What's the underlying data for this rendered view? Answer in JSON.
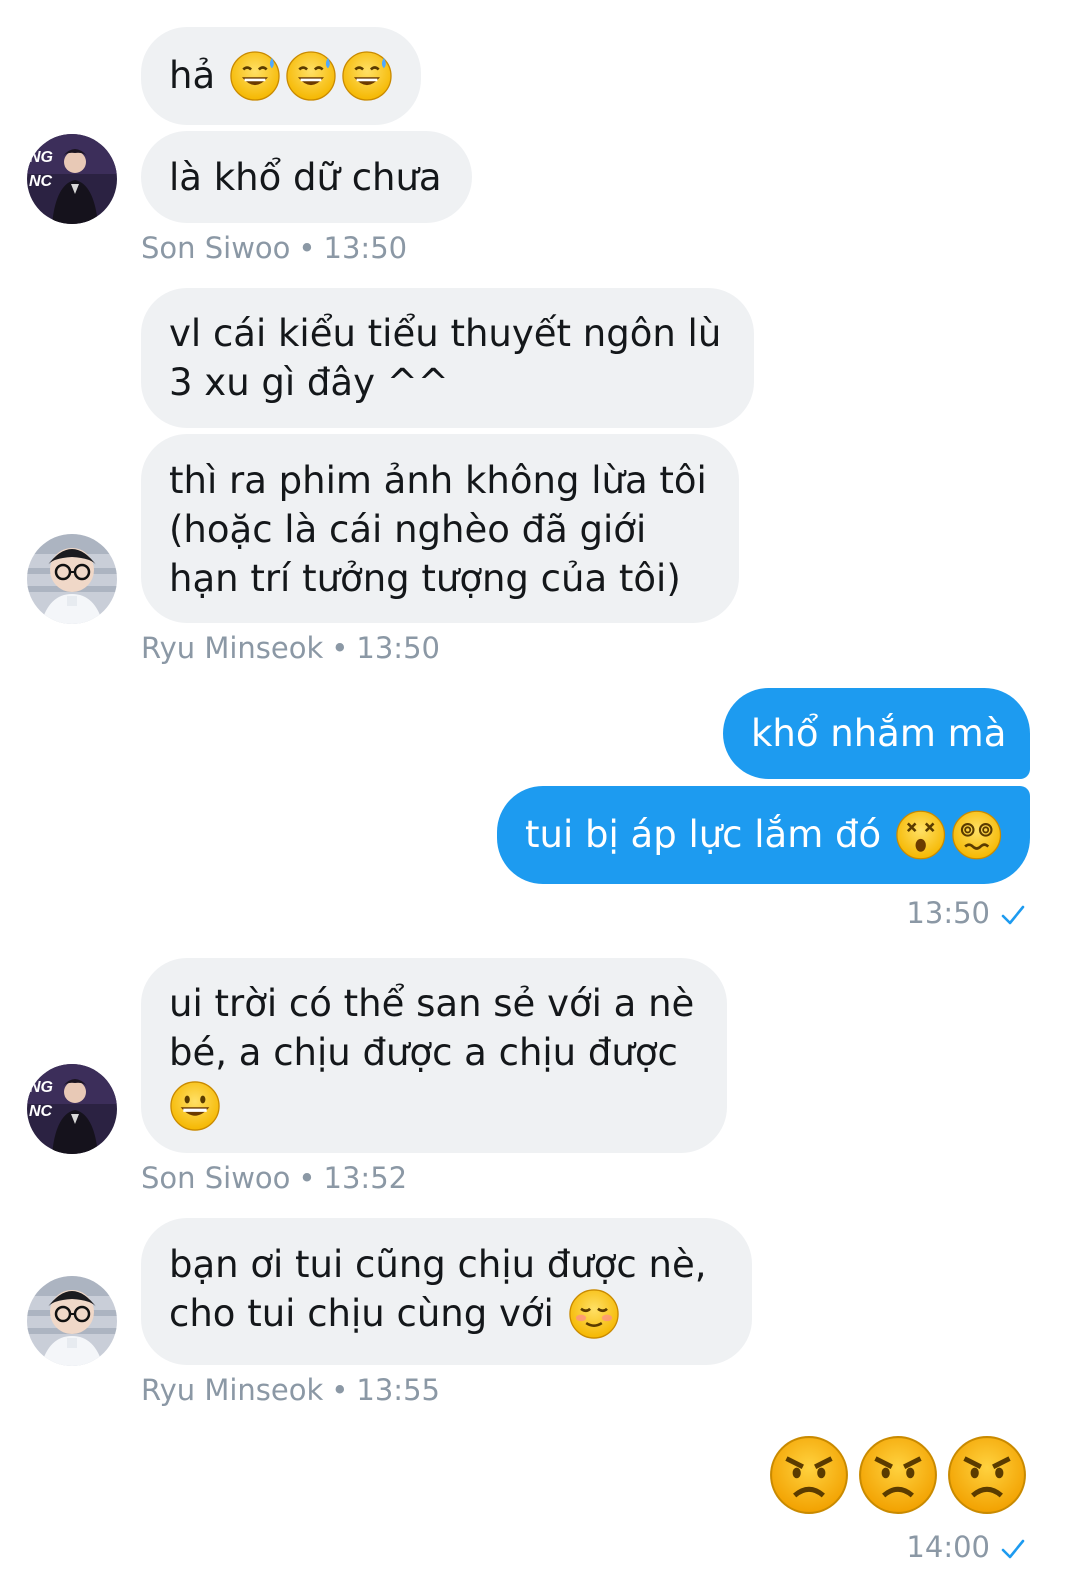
{
  "messages": [
    {
      "sender": "Son Siwoo",
      "text": "hả"
    },
    {
      "sender": "Son Siwoo",
      "text": "là khổ dữ chưa"
    },
    {
      "meta": {
        "name": "Son Siwoo",
        "sep": "•",
        "time": "13:50"
      }
    },
    {
      "sender": "Ryu Minseok",
      "lines": [
        "vl cái kiểu tiểu thuyết ngôn lù",
        "3 xu gì đây ^^"
      ]
    },
    {
      "sender": "Ryu Minseok",
      "lines": [
        "thì ra phim ảnh không lừa tôi",
        "(hoặc là cái nghèo đã giới",
        "hạn trí tưởng tượng của tôi)"
      ]
    },
    {
      "meta": {
        "name": "Ryu Minseok",
        "sep": "•",
        "time": "13:50"
      }
    },
    {
      "sender": "me",
      "text": "khổ nhắm mà"
    },
    {
      "sender": "me",
      "text": "tui bị áp lực lắm đó"
    },
    {
      "meta_out": {
        "time": "13:50"
      }
    },
    {
      "sender": "Son Siwoo",
      "lines": [
        "ui trời có thể san sẻ với a nè",
        "bé, a chịu được a chịu được"
      ]
    },
    {
      "meta": {
        "name": "Son Siwoo",
        "sep": "•",
        "time": "13:52"
      }
    },
    {
      "sender": "Ryu Minseok",
      "lines": [
        "bạn ơi tui cũng chịu được nè,",
        "cho tui chịu cùng với"
      ]
    },
    {
      "meta": {
        "name": "Ryu Minseok",
        "sep": "•",
        "time": "13:55"
      }
    },
    {
      "meta_out": {
        "time": "14:00"
      }
    }
  ],
  "icons": {
    "sent": "checkmark-icon",
    "emoji_sweat": "grinning-sweat-emoji",
    "emoji_dizzy": "dizzy-face-emoji",
    "emoji_woozy": "woozy-face-emoji",
    "emoji_grin": "grinning-emoji",
    "emoji_smile": "smiling-face-emoji",
    "emoji_angry": "angry-face-emoji"
  },
  "colors": {
    "outgoing": "#1d9bf0",
    "incoming": "#eff1f3",
    "meta": "#8b98a5"
  }
}
